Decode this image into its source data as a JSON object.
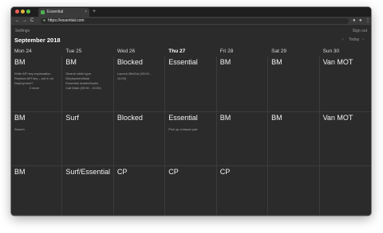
{
  "browser": {
    "tab_title": "Essential",
    "tab_close": "×",
    "new_tab": "+",
    "url": "https://essential.com",
    "back": "←",
    "forward": "→",
    "reload": "C"
  },
  "app": {
    "settings_label": "Settings",
    "signout_label": "Sign out"
  },
  "calendar": {
    "month_label": "September 2018",
    "prev": "‹",
    "today_label": "Today",
    "next": "›",
    "days": [
      {
        "label": "Mon 24",
        "today": false
      },
      {
        "label": "Tue 25",
        "today": false
      },
      {
        "label": "Wed 26",
        "today": false
      },
      {
        "label": "Thu 27",
        "today": true
      },
      {
        "label": "Fri 28",
        "today": false
      },
      {
        "label": "Sat 29",
        "today": false
      },
      {
        "label": "Sun 30",
        "today": false
      }
    ],
    "weeks": [
      [
        {
          "title": "BM",
          "items": [
            "Write API key explanation",
            "Replace API key – put in on",
            "Deployment?"
          ],
          "more": "3 more"
        },
        {
          "title": "BM",
          "items": [
            "Search while type",
            "Deployment/task",
            "Essential reader/books",
            "Call Mark (09:00 - 10:00)"
          ]
        },
        {
          "title": "Blocked",
          "items": [
            "Launch MiniCal (09:00 -",
            "10:00)"
          ]
        },
        {
          "title": "Essential",
          "items": []
        },
        {
          "title": "BM",
          "items": []
        },
        {
          "title": "BM",
          "items": []
        },
        {
          "title": "Van MOT",
          "items": []
        }
      ],
      [
        {
          "title": "BM",
          "items": [
            "Search"
          ]
        },
        {
          "title": "Surf",
          "items": []
        },
        {
          "title": "Blocked",
          "items": []
        },
        {
          "title": "Essential",
          "items": [
            "Pick up exhaust part"
          ]
        },
        {
          "title": "BM",
          "items": []
        },
        {
          "title": "BM",
          "items": []
        },
        {
          "title": "Van MOT",
          "items": []
        }
      ],
      [
        {
          "title": "BM",
          "items": []
        },
        {
          "title": "Surf/Essential",
          "items": []
        },
        {
          "title": "CP",
          "items": []
        },
        {
          "title": "CP",
          "items": []
        },
        {
          "title": "CP",
          "items": []
        },
        {
          "title": "",
          "items": []
        },
        {
          "title": "",
          "items": []
        }
      ]
    ]
  }
}
